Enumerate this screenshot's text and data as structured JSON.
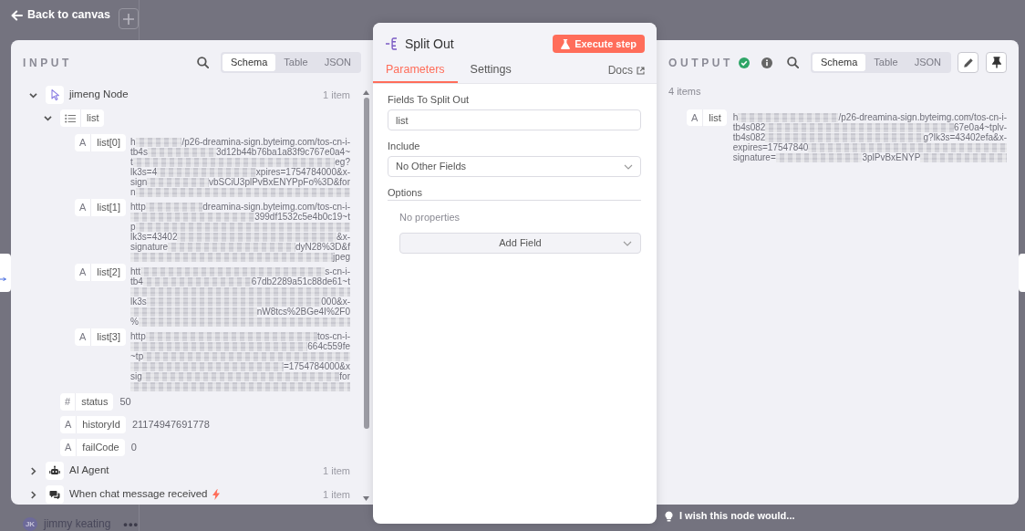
{
  "canvas": {
    "back_link": "Back to canvas",
    "user": {
      "initials": "JK",
      "name": "jimmy keating",
      "menu": "•••"
    },
    "feedback_link": "I wish this node would..."
  },
  "input": {
    "heading": "INPUT",
    "views": [
      {
        "label": "Schema",
        "selected": true
      },
      {
        "label": "Table",
        "selected": false
      },
      {
        "label": "JSON",
        "selected": false
      }
    ],
    "nodes": [
      {
        "name": "jimeng Node",
        "count": "1 item",
        "expanded": true,
        "trigger": false,
        "children": [
          {
            "kind": "array",
            "name": "list",
            "expanded": true,
            "children": [
              {
                "kind": "string",
                "glyph": "A",
                "name": "list[0]",
                "value_lines": [
                  [
                    {
                      "kind": "text",
                      "text": "h"
                    },
                    {
                      "kind": "blur"
                    },
                    {
                      "kind": "text",
                      "text": "/p26-dreamina-sign.byteimg.com/tos-cn-i-"
                    }
                  ],
                  [
                    {
                      "kind": "text",
                      "text": "tb4s"
                    },
                    {
                      "kind": "blur"
                    },
                    {
                      "kind": "text",
                      "text": "3d12b44b76ba1a83f9c767e0a4~"
                    }
                  ],
                  [
                    {
                      "kind": "text",
                      "text": "t"
                    },
                    {
                      "kind": "blur"
                    },
                    {
                      "kind": "text",
                      "text": "eg?"
                    }
                  ],
                  [
                    {
                      "kind": "text",
                      "text": "lk3s=4"
                    },
                    {
                      "kind": "blur"
                    },
                    {
                      "kind": "text",
                      "text": "xpires=1754784000&x-"
                    }
                  ],
                  [
                    {
                      "kind": "text",
                      "text": "sign"
                    },
                    {
                      "kind": "blur"
                    },
                    {
                      "kind": "text",
                      "text": "vbSCiU3plPvBxENYPpFo%3D&for"
                    }
                  ],
                  [
                    {
                      "kind": "text",
                      "text": "n"
                    },
                    {
                      "kind": "blur"
                    }
                  ]
                ]
              },
              {
                "kind": "string",
                "glyph": "A",
                "name": "list[1]",
                "value_lines": [
                  [
                    {
                      "kind": "text",
                      "text": "http"
                    },
                    {
                      "kind": "blur"
                    },
                    {
                      "kind": "text",
                      "text": "dreamina-sign.byteimg.com/tos-cn-i-"
                    }
                  ],
                  [
                    {
                      "kind": "blur"
                    },
                    {
                      "kind": "text",
                      "text": "399df1532c5e4b0c19~t"
                    }
                  ],
                  [
                    {
                      "kind": "text",
                      "text": "p"
                    },
                    {
                      "kind": "blur"
                    }
                  ],
                  [
                    {
                      "kind": "text",
                      "text": "lk3s=43402"
                    },
                    {
                      "kind": "blur"
                    },
                    {
                      "kind": "text",
                      "text": "&x-"
                    }
                  ],
                  [
                    {
                      "kind": "text",
                      "text": "signature"
                    },
                    {
                      "kind": "blur"
                    },
                    {
                      "kind": "text",
                      "text": "dyN28%3D&f"
                    }
                  ],
                  [
                    {
                      "kind": "blur"
                    },
                    {
                      "kind": "text",
                      "text": "jpeg"
                    }
                  ]
                ]
              },
              {
                "kind": "string",
                "glyph": "A",
                "name": "list[2]",
                "value_lines": [
                  [
                    {
                      "kind": "text",
                      "text": "htt"
                    },
                    {
                      "kind": "blur"
                    },
                    {
                      "kind": "text",
                      "text": "s-cn-i-"
                    }
                  ],
                  [
                    {
                      "kind": "text",
                      "text": "tb4"
                    },
                    {
                      "kind": "blur"
                    },
                    {
                      "kind": "text",
                      "text": "67db2289a51c88de61~t"
                    }
                  ],
                  [
                    {
                      "kind": "blur"
                    }
                  ],
                  [
                    {
                      "kind": "text",
                      "text": "lk3s"
                    },
                    {
                      "kind": "blur"
                    },
                    {
                      "kind": "text",
                      "text": "000&x-"
                    }
                  ],
                  [
                    {
                      "kind": "blur"
                    },
                    {
                      "kind": "text",
                      "text": "nW8tcs%2BGe4I%2F0"
                    }
                  ],
                  [
                    {
                      "kind": "text",
                      "text": "%"
                    },
                    {
                      "kind": "blur"
                    }
                  ]
                ]
              },
              {
                "kind": "string",
                "glyph": "A",
                "name": "list[3]",
                "value_lines": [
                  [
                    {
                      "kind": "text",
                      "text": "http"
                    },
                    {
                      "kind": "blur"
                    },
                    {
                      "kind": "text",
                      "text": "tos-cn-i-"
                    }
                  ],
                  [
                    {
                      "kind": "blur"
                    },
                    {
                      "kind": "text",
                      "text": "664c559fe"
                    }
                  ],
                  [
                    {
                      "kind": "text",
                      "text": "~tp"
                    },
                    {
                      "kind": "blur"
                    }
                  ],
                  [
                    {
                      "kind": "blur"
                    },
                    {
                      "kind": "text",
                      "text": "=1754784000&x"
                    }
                  ],
                  [
                    {
                      "kind": "text",
                      "text": "sig"
                    },
                    {
                      "kind": "blur"
                    },
                    {
                      "kind": "text",
                      "text": "for"
                    }
                  ],
                  [
                    {
                      "kind": "blur"
                    }
                  ]
                ]
              }
            ]
          },
          {
            "kind": "number",
            "glyph": "#",
            "name": "status",
            "value": "50"
          },
          {
            "kind": "string",
            "glyph": "A",
            "name": "historyId",
            "value": "21174947691778"
          },
          {
            "kind": "string",
            "glyph": "A",
            "name": "failCode",
            "value": "0"
          }
        ]
      },
      {
        "name": "AI Agent",
        "count": "1 item",
        "expanded": false,
        "trigger": false
      },
      {
        "name": "When chat message received",
        "count": "1 item",
        "expanded": false,
        "trigger": true
      }
    ]
  },
  "node": {
    "title": "Split Out",
    "execute_button": "Execute step",
    "tabs": [
      {
        "label": "Parameters",
        "selected": true
      },
      {
        "label": "Settings",
        "selected": false
      }
    ],
    "docs_link": "Docs",
    "parameters": [
      {
        "label": "Fields To Split Out",
        "kind": "text",
        "value": "list"
      },
      {
        "label": "Include",
        "kind": "select",
        "value": "No Other Fields"
      }
    ],
    "options": {
      "label": "Options",
      "empty_text": "No properties",
      "add_button": "Add Field"
    }
  },
  "output": {
    "heading": "OUTPUT",
    "success": true,
    "views": [
      {
        "label": "Schema",
        "selected": true
      },
      {
        "label": "Table",
        "selected": false
      },
      {
        "label": "JSON",
        "selected": false
      }
    ],
    "count": "4 items",
    "fields": [
      {
        "kind": "string",
        "glyph": "A",
        "name": "list",
        "value_lines": [
          [
            {
              "kind": "text",
              "text": "h"
            },
            {
              "kind": "blur"
            },
            {
              "kind": "text",
              "text": "/p26-dreamina-sign.byteimg.com/tos-cn-i-"
            }
          ],
          [
            {
              "kind": "text",
              "text": "tb4s082"
            },
            {
              "kind": "blur"
            },
            {
              "kind": "text",
              "text": "67e0a4~tplv-"
            }
          ],
          [
            {
              "kind": "text",
              "text": "tb4s082"
            },
            {
              "kind": "blur"
            },
            {
              "kind": "text",
              "text": "g?lk3s=43402efa&x-"
            }
          ],
          [
            {
              "kind": "text",
              "text": "expires=17547840"
            },
            {
              "kind": "blur"
            }
          ],
          [
            {
              "kind": "text",
              "text": "signature="
            },
            {
              "kind": "blur"
            },
            {
              "kind": "text",
              "text": "3plPvBxENYP"
            },
            {
              "kind": "blur"
            }
          ]
        ]
      }
    ]
  }
}
